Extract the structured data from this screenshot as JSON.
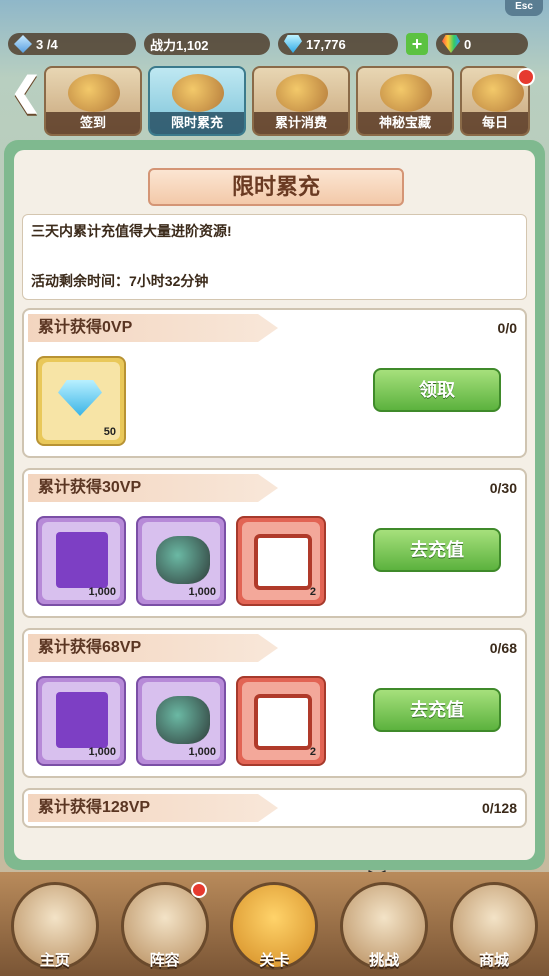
{
  "topbar": {
    "energy": "3 /4",
    "power": "战力1,102",
    "diamonds": "17,776",
    "add_label": "+",
    "gems": "0",
    "esc_label": "Esc"
  },
  "tabs": [
    {
      "label": "签到",
      "active": false
    },
    {
      "label": "限时累充",
      "active": true
    },
    {
      "label": "累计消费",
      "active": false
    },
    {
      "label": "神秘宝藏",
      "active": false
    },
    {
      "label": "每日",
      "active": false
    }
  ],
  "panel": {
    "title": "限时累充",
    "description": "三天内累计充值得大量进阶资源!",
    "time_left": "活动剩余时间：7小时32分钟"
  },
  "rewards": [
    {
      "title": "累计获得0VP",
      "progress": "0/0",
      "button": "领取",
      "items": [
        {
          "type": "diamond",
          "qty": "50"
        }
      ]
    },
    {
      "title": "累计获得30VP",
      "progress": "0/30",
      "button": "去充值",
      "items": [
        {
          "type": "book",
          "qty": "1,000"
        },
        {
          "type": "rock",
          "qty": "1,000"
        },
        {
          "type": "chest",
          "qty": "2"
        }
      ]
    },
    {
      "title": "累计获得68VP",
      "progress": "0/68",
      "button": "去充值",
      "items": [
        {
          "type": "book",
          "qty": "1,000"
        },
        {
          "type": "rock",
          "qty": "1,000"
        },
        {
          "type": "chest",
          "qty": "2"
        }
      ]
    },
    {
      "title": "累计获得128VP",
      "progress": "0/128"
    }
  ],
  "bottom_nav": [
    {
      "label": "主页"
    },
    {
      "label": "阵容"
    },
    {
      "label": "关卡"
    },
    {
      "label": "挑战"
    },
    {
      "label": "商城"
    }
  ],
  "colors": {
    "accent_green": "#5cb23e",
    "panel_green": "#7fb98f",
    "badge_red": "#e63a2f"
  },
  "icons": [
    "diamond-icon",
    "power-icon",
    "plus-icon",
    "gem-icon",
    "left-arrow-icon"
  ]
}
